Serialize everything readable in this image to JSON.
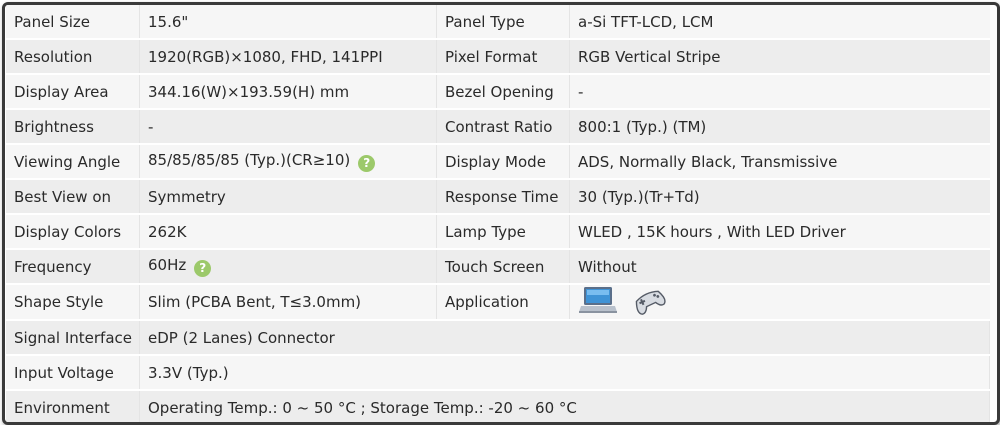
{
  "specs": [
    {
      "label": "Panel Size",
      "value": "15.6\"",
      "label2": "Panel Type",
      "value2": "a-Si TFT-LCD, LCM"
    },
    {
      "label": "Resolution",
      "value": "1920(RGB)×1080, FHD, 141PPI",
      "label2": "Pixel Format",
      "value2": "RGB Vertical Stripe"
    },
    {
      "label": "Display Area",
      "value": "344.16(W)×193.59(H) mm",
      "label2": "Bezel Opening",
      "value2": "-"
    },
    {
      "label": "Brightness",
      "value": "-",
      "label2": "Contrast Ratio",
      "value2": "800:1 (Typ.) (TM)"
    },
    {
      "label": "Viewing Angle",
      "value": "85/85/85/85 (Typ.)(CR≥10)",
      "label2": "Display Mode",
      "value2": "ADS, Normally Black, Transmissive"
    },
    {
      "label": "Best View on",
      "value": "Symmetry",
      "label2": "Response Time",
      "value2": "30 (Typ.)(Tr+Td)"
    },
    {
      "label": "Display Colors",
      "value": "262K",
      "label2": "Lamp Type",
      "value2": "WLED , 15K hours , With LED Driver"
    },
    {
      "label": "Frequency",
      "value": "60Hz",
      "label2": "Touch Screen",
      "value2": "Without"
    },
    {
      "label": "Shape Style",
      "value": "Slim (PCBA Bent, T≤3.0mm)",
      "label2": "Application",
      "value2": ""
    },
    {
      "label": "Signal Interface",
      "value": "eDP (2 Lanes) Connector"
    },
    {
      "label": "Input Voltage",
      "value": "3.3V (Typ.)"
    },
    {
      "label": "Environment",
      "value": "Operating Temp.: 0 ~ 50 °C ; Storage Temp.: -20 ~ 60 °C"
    }
  ],
  "help_glyph": "?",
  "icons": {
    "help": "question-circle-icon",
    "app1": "laptop-icon",
    "app2": "gamepad-icon"
  },
  "colors": {
    "help_bg": "#9cc96a",
    "row_odd": "#f6f6f6",
    "row_even": "#ededed",
    "border": "#3a3a3a"
  }
}
